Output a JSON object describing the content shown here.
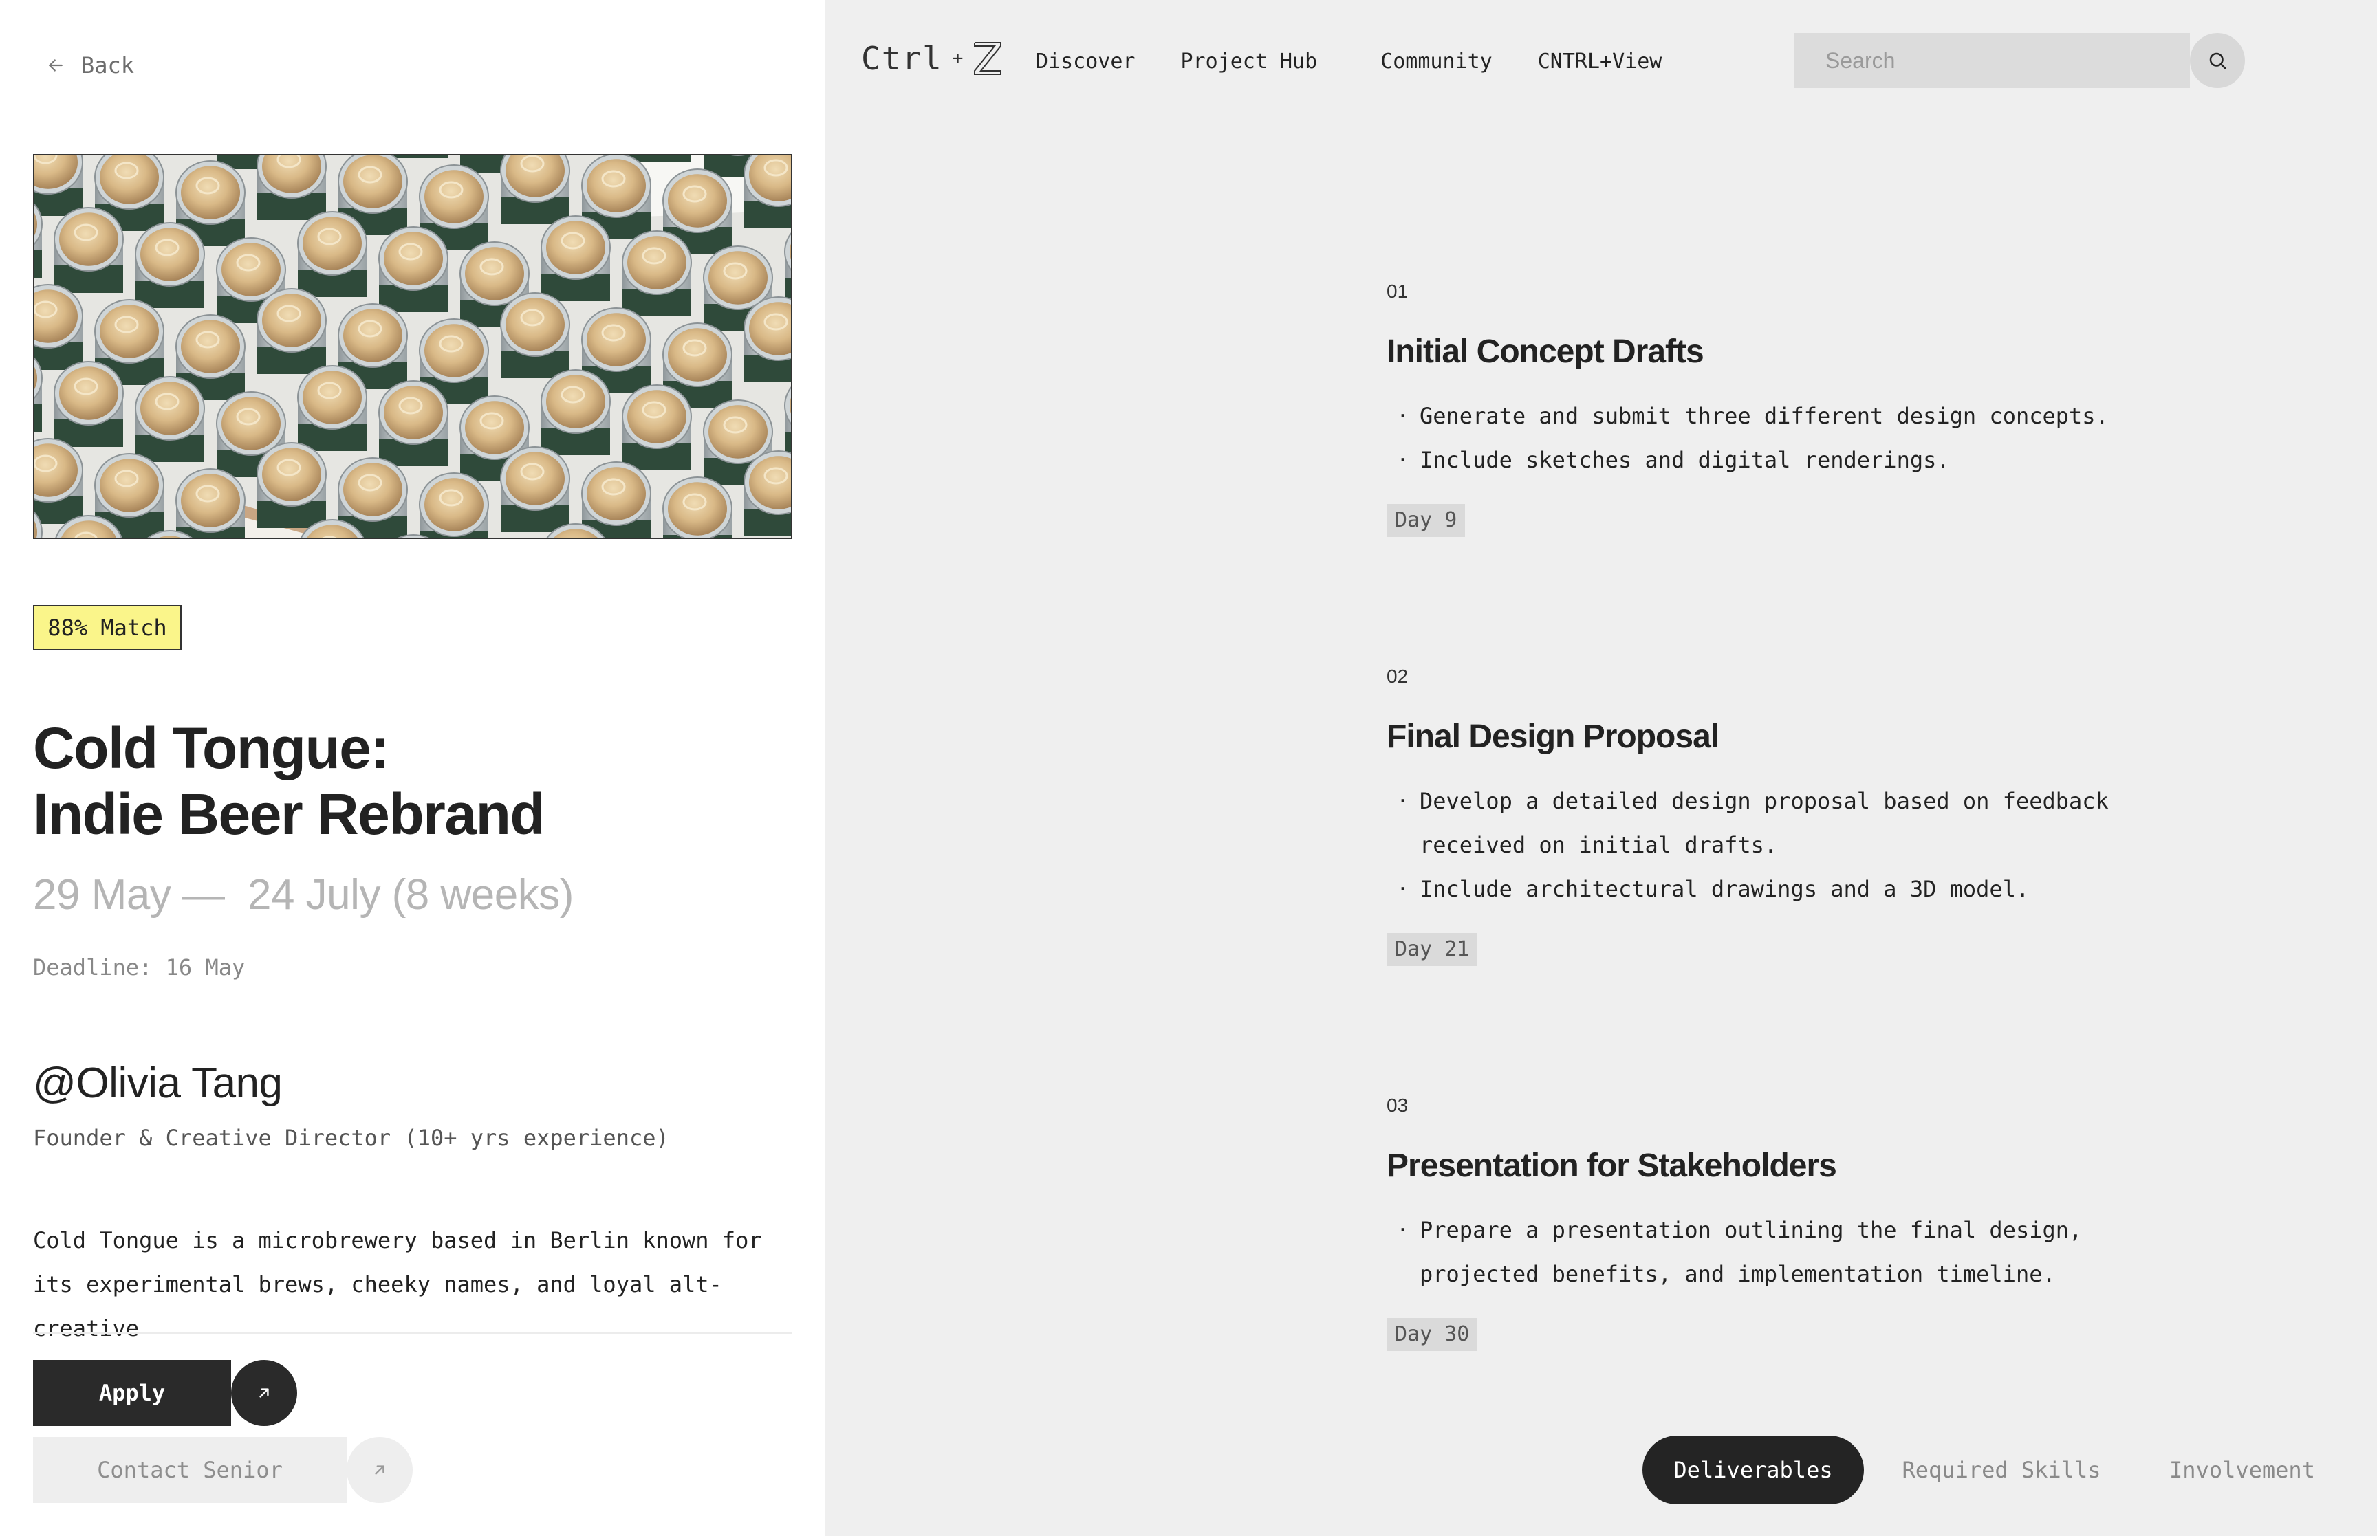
{
  "back": {
    "label": "Back"
  },
  "hero": {
    "image_alt": "Cans of Italian Pilsner in a box"
  },
  "match": {
    "label": "88% Match"
  },
  "project": {
    "title_line1": "Cold Tongue:",
    "title_line2": "Indie Beer Rebrand",
    "dates": "29 May —  24 July (8 weeks)",
    "deadline": "Deadline: 16 May"
  },
  "owner": {
    "handle": "@Olivia Tang",
    "role": "Founder & Creative Director (10+ yrs experience)"
  },
  "description": "Cold Tongue is a microbrewery based in Berlin known for its experimental brews, cheeky names, and loyal alt-creative",
  "actions": {
    "apply_label": "Apply",
    "contact_label": "Contact Senior"
  },
  "header": {
    "logo_left": "Ctrl",
    "logo_plus": "+",
    "nav": [
      "Discover",
      "Project Hub",
      "Community",
      "CNTRL+View"
    ],
    "search_placeholder": "Search"
  },
  "deliverables": [
    {
      "number": "01",
      "title": "Initial Concept Drafts",
      "bullets": [
        "Generate and submit three different design concepts.",
        "Include sketches and digital renderings."
      ],
      "day": "Day 9"
    },
    {
      "number": "02",
      "title": "Final Design Proposal",
      "bullets": [
        "Develop a detailed design proposal based on feedback received on initial drafts.",
        "Include architectural drawings and a 3D model."
      ],
      "day": "Day 21"
    },
    {
      "number": "03",
      "title": "Presentation for Stakeholders",
      "bullets": [
        "Prepare a presentation outlining the final design, projected benefits, and implementation timeline."
      ],
      "day": "Day 30"
    }
  ],
  "tabs": [
    "Deliverables",
    "Required Skills",
    "Involvement"
  ],
  "colors": {
    "accent_dark": "#242424",
    "match_badge": "#faf58a",
    "panel_bg": "#efefef"
  },
  "icons": [
    "arrow-left-icon",
    "arrow-up-right-icon",
    "search-icon"
  ]
}
